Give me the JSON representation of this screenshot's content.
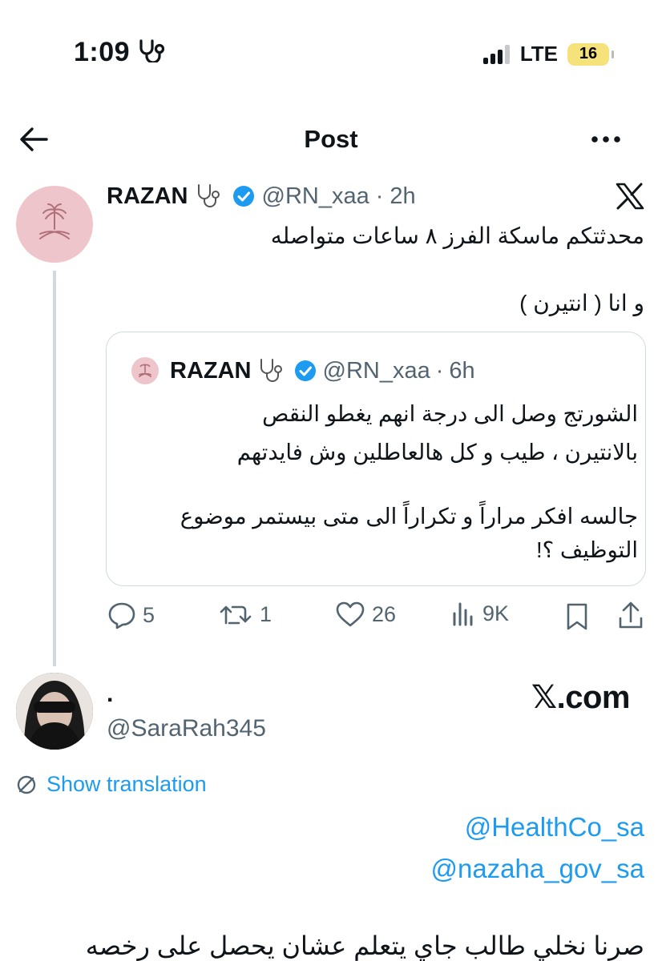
{
  "status_bar": {
    "time": "1:09",
    "network": "LTE",
    "battery": "16"
  },
  "header": {
    "title": "Post"
  },
  "post": {
    "author_name": "RAZAN",
    "handle": "@RN_xaa",
    "separator": "·",
    "time": "2h",
    "text_line1": "محدثتكم ماسكة الفرز ٨ ساعات متواصله",
    "text_line2": "و انا ( انتيرن )"
  },
  "quoted_post": {
    "author_name": "RAZAN",
    "handle": "@RN_xaa",
    "separator": "·",
    "time": "6h",
    "line1": "الشورتج وصل الى درجة انهم يغطو النقص",
    "line2": "بالانتيرن ، طيب و كل هالعاطلين وش فايدتهم",
    "line3": "جالسه افكر مراراً و تكراراً الى متى بيستمر موضوع",
    "line4": "التوظيف ؟!"
  },
  "actions": {
    "replies": "5",
    "reposts": "1",
    "likes": "26",
    "views": "9K"
  },
  "reply": {
    "name": ".",
    "handle": "@SaraRah345",
    "watermark": "𝕏.com",
    "show_translation": "Show translation",
    "mention1": "@HealthCo_sa",
    "mention2": "@nazaha_gov_sa",
    "text": "صرنا نخلي طالب جاي يتعلم عشان يحصل على رخصه"
  },
  "colors": {
    "accent": "#1d9bf0",
    "muted": "#536471",
    "avatar_pink": "#efc5cc",
    "verified": "#1d9bf0",
    "battery": "#f6e27a"
  }
}
